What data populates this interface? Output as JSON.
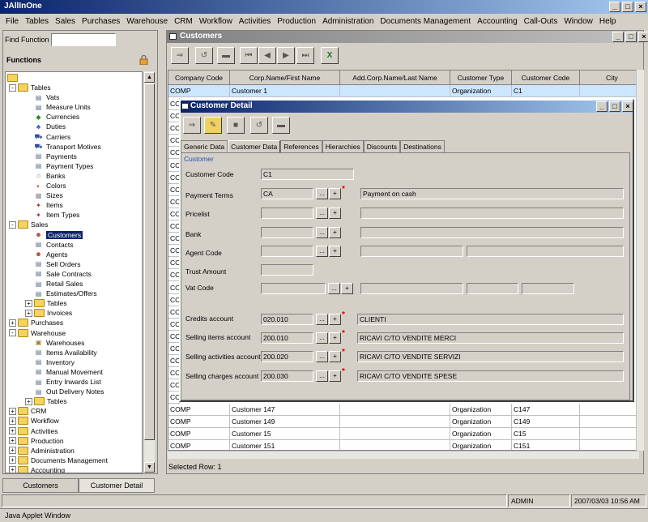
{
  "app": {
    "title": "JAllInOne"
  },
  "menu": [
    "File",
    "Tables",
    "Sales",
    "Purchases",
    "Warehouse",
    "CRM",
    "Workflow",
    "Activities",
    "Production",
    "Administration",
    "Documents Management",
    "Accounting",
    "Call-Outs",
    "Window",
    "Help"
  ],
  "left_panel": {
    "find_label": "Find Function",
    "find_value": "",
    "functions_label": "Functions",
    "tree": [
      {
        "label": "Tables",
        "level": 1,
        "type": "folder",
        "toggle": "-"
      },
      {
        "label": "Vats",
        "level": 2,
        "type": "doc"
      },
      {
        "label": "Measure Units",
        "level": 2,
        "type": "doc"
      },
      {
        "label": "Currencies",
        "level": 2,
        "type": "money"
      },
      {
        "label": "Duties",
        "level": 2,
        "type": "duty"
      },
      {
        "label": "Carriers",
        "level": 2,
        "type": "car"
      },
      {
        "label": "Transport Motives",
        "level": 2,
        "type": "car"
      },
      {
        "label": "Payments",
        "level": 2,
        "type": "doc"
      },
      {
        "label": "Payment Types",
        "level": 2,
        "type": "doc"
      },
      {
        "label": "Banks",
        "level": 2,
        "type": "bank"
      },
      {
        "label": "Colors",
        "level": 2,
        "type": "color"
      },
      {
        "label": "Sizes",
        "level": 2,
        "type": "size"
      },
      {
        "label": "Items",
        "level": 2,
        "type": "item"
      },
      {
        "label": "Item Types",
        "level": 2,
        "type": "item"
      },
      {
        "label": "Sales",
        "level": 1,
        "type": "folder",
        "toggle": "-"
      },
      {
        "label": "Customers",
        "level": 2,
        "type": "person",
        "selected": true
      },
      {
        "label": "Contacts",
        "level": 2,
        "type": "doc"
      },
      {
        "label": "Agents",
        "level": 2,
        "type": "person"
      },
      {
        "label": "Sell Orders",
        "level": 2,
        "type": "doc"
      },
      {
        "label": "Sale Contracts",
        "level": 2,
        "type": "doc"
      },
      {
        "label": "Retail Sales",
        "level": 2,
        "type": "doc"
      },
      {
        "label": "Estimates/Offers",
        "level": 2,
        "type": "doc"
      },
      {
        "label": "Tables",
        "level": 2,
        "type": "folder",
        "toggle": "+"
      },
      {
        "label": "Invoices",
        "level": 2,
        "type": "folder",
        "toggle": "+"
      },
      {
        "label": "Purchases",
        "level": 1,
        "type": "folder",
        "toggle": "+"
      },
      {
        "label": "Warehouse",
        "level": 1,
        "type": "folder",
        "toggle": "-"
      },
      {
        "label": "Warehouses",
        "level": 2,
        "type": "wh"
      },
      {
        "label": "Items Availability",
        "level": 2,
        "type": "doc"
      },
      {
        "label": "Inventory",
        "level": 2,
        "type": "doc"
      },
      {
        "label": "Manual Movement",
        "level": 2,
        "type": "doc"
      },
      {
        "label": "Entry Inwards List",
        "level": 2,
        "type": "doc"
      },
      {
        "label": "Out Delivery Notes",
        "level": 2,
        "type": "doc"
      },
      {
        "label": "Tables",
        "level": 2,
        "type": "folder",
        "toggle": "+"
      },
      {
        "label": "CRM",
        "level": 1,
        "type": "folder",
        "toggle": "+"
      },
      {
        "label": "Workflow",
        "level": 1,
        "type": "folder",
        "toggle": "+"
      },
      {
        "label": "Activities",
        "level": 1,
        "type": "folder",
        "toggle": "+"
      },
      {
        "label": "Production",
        "level": 1,
        "type": "folder",
        "toggle": "+"
      },
      {
        "label": "Administration",
        "level": 1,
        "type": "folder",
        "toggle": "+"
      },
      {
        "label": "Documents Management",
        "level": 1,
        "type": "folder",
        "toggle": "+"
      },
      {
        "label": "Accounting",
        "level": 1,
        "type": "folder",
        "toggle": "+"
      }
    ]
  },
  "customers_window": {
    "title": "Customers",
    "columns": [
      "Company Code",
      "Corp.Name/First Name",
      "Add.Corp.Name/Last Name",
      "Customer Type",
      "Customer Code",
      "City"
    ],
    "first_row": [
      "COMP",
      "Customer 1",
      "",
      "Organization",
      "C1",
      ""
    ],
    "hidden_row_code": "CC",
    "bottom_rows": [
      [
        "COMP",
        "Customer 147",
        "",
        "Organization",
        "C147",
        ""
      ],
      [
        "COMP",
        "Customer 149",
        "",
        "Organization",
        "C149",
        ""
      ],
      [
        "COMP",
        "Customer 15",
        "",
        "Organization",
        "C15",
        ""
      ],
      [
        "COMP",
        "Customer 151",
        "",
        "Organization",
        "C151",
        ""
      ]
    ],
    "status": "Selected Row: 1"
  },
  "detail_window": {
    "title": "Customer Detail",
    "tabs": [
      "Generic Data",
      "Customer Data",
      "References",
      "Hierarchies",
      "Discounts",
      "Destinations"
    ],
    "active_tab": "Customer Data",
    "group_label": "Customer",
    "fields": {
      "customer_code": {
        "label": "Customer Code",
        "value": "C1"
      },
      "payment_terms": {
        "label": "Payment Terms",
        "value": "CA",
        "desc": "Payment on cash"
      },
      "pricelist": {
        "label": "Pricelist",
        "value": "",
        "desc": ""
      },
      "bank": {
        "label": "Bank",
        "value": "",
        "desc": ""
      },
      "agent_code": {
        "label": "Agent Code",
        "value": "",
        "desc": ""
      },
      "trust_amount": {
        "label": "Trust Amount",
        "value": ""
      },
      "vat_code": {
        "label": "Vat Code",
        "value": ""
      },
      "credits_account": {
        "label": "Credits account",
        "value": "020.010",
        "desc": "CLIENTI"
      },
      "selling_items_account": {
        "label": "Selling items account",
        "value": "200.010",
        "desc": "RICAVI C/TO VENDITE MERCI"
      },
      "selling_activities_account": {
        "label": "Selling activities account",
        "value": "200.020",
        "desc": "RICAVI C/TO VENDITE SERVIZI"
      },
      "selling_charges_account": {
        "label": "Selling charges account",
        "value": "200.030",
        "desc": "RICAVI C/TO VENDITE SPESE"
      }
    },
    "lookup_btn": "...",
    "add_btn": "+",
    "required_mark": "*"
  },
  "bottom_tabs": [
    "Customers",
    "Customer Detail"
  ],
  "statusbar": {
    "user": "ADMIN",
    "datetime": "2007/03/03 10:56 AM"
  },
  "applet_label": "Java Applet Window",
  "window_buttons": {
    "min": "_",
    "max": "□",
    "close": "×"
  },
  "colors": {
    "title_active": "#0a246a",
    "title_inactive": "#808080",
    "selection": "#0a246a",
    "required": "#e00000",
    "group_label": "#2c4fb5"
  }
}
